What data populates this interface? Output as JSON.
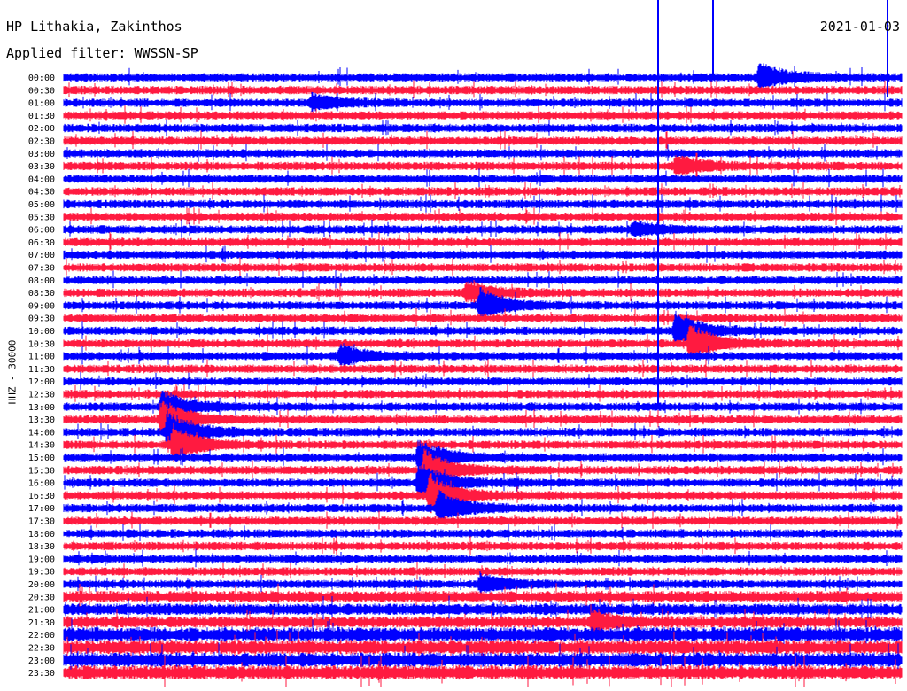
{
  "header": {
    "station": "HP Lithakia, Zakinthos",
    "filter": "Applied filter: WWSSN-SP",
    "date": "2021-01-03"
  },
  "chart_data": {
    "type": "line",
    "title": "HP Lithakia, Zakinthos",
    "subtitle": "Applied filter: WWSSN-SP",
    "date": "2021-01-03",
    "ylabel": "HHZ - 30000",
    "row_times": [
      "00:00",
      "00:30",
      "01:00",
      "01:30",
      "02:00",
      "02:30",
      "03:00",
      "03:30",
      "04:00",
      "04:30",
      "05:00",
      "05:30",
      "06:00",
      "06:30",
      "07:00",
      "07:30",
      "08:00",
      "08:30",
      "09:00",
      "09:30",
      "10:00",
      "10:30",
      "11:00",
      "11:30",
      "12:00",
      "12:30",
      "13:00",
      "13:30",
      "14:00",
      "14:30",
      "15:00",
      "15:30",
      "16:00",
      "16:30",
      "17:00",
      "17:30",
      "18:00",
      "18:30",
      "19:00",
      "19:30",
      "20:00",
      "20:30",
      "21:00",
      "21:30",
      "22:00",
      "22:30",
      "23:00",
      "23:30"
    ],
    "trace_colors": [
      "#0000ff",
      "#ff1a40"
    ],
    "grid": false,
    "legend": "none",
    "events": [
      {
        "time": "00:00",
        "minute": 25,
        "level": 0.75
      },
      {
        "time": "01:00",
        "minute": 9,
        "level": 0.45
      },
      {
        "time": "03:30",
        "minute": 22,
        "level": 0.5
      },
      {
        "time": "06:00",
        "minute": 20.5,
        "level": 0.35
      },
      {
        "time": "08:30",
        "minute": 14.5,
        "level": 0.55
      },
      {
        "time": "09:00",
        "minute": 15,
        "level": 0.8
      },
      {
        "time": "10:00",
        "minute": 22,
        "level": 0.9
      },
      {
        "time": "10:30",
        "minute": 22.5,
        "level": 0.9
      },
      {
        "time": "11:00",
        "minute": 10,
        "level": 0.55
      },
      {
        "time": "13:00",
        "minute": 3.6,
        "level": 0.8
      },
      {
        "time": "13:30",
        "minute": 3.6,
        "level": 1.0
      },
      {
        "time": "14:00",
        "minute": 3.8,
        "level": 1.0
      },
      {
        "time": "14:30",
        "minute": 4.0,
        "level": 1.0
      },
      {
        "time": "15:00",
        "minute": 12.8,
        "level": 0.85
      },
      {
        "time": "15:30",
        "minute": 13.0,
        "level": 1.0
      },
      {
        "time": "16:00",
        "minute": 12.8,
        "level": 1.0
      },
      {
        "time": "16:30",
        "minute": 13.2,
        "level": 1.0
      },
      {
        "time": "17:00",
        "minute": 13.5,
        "level": 0.85
      },
      {
        "time": "20:00",
        "minute": 15,
        "level": 0.5
      },
      {
        "time": "21:30",
        "minute": 19,
        "level": 0.45
      }
    ]
  }
}
